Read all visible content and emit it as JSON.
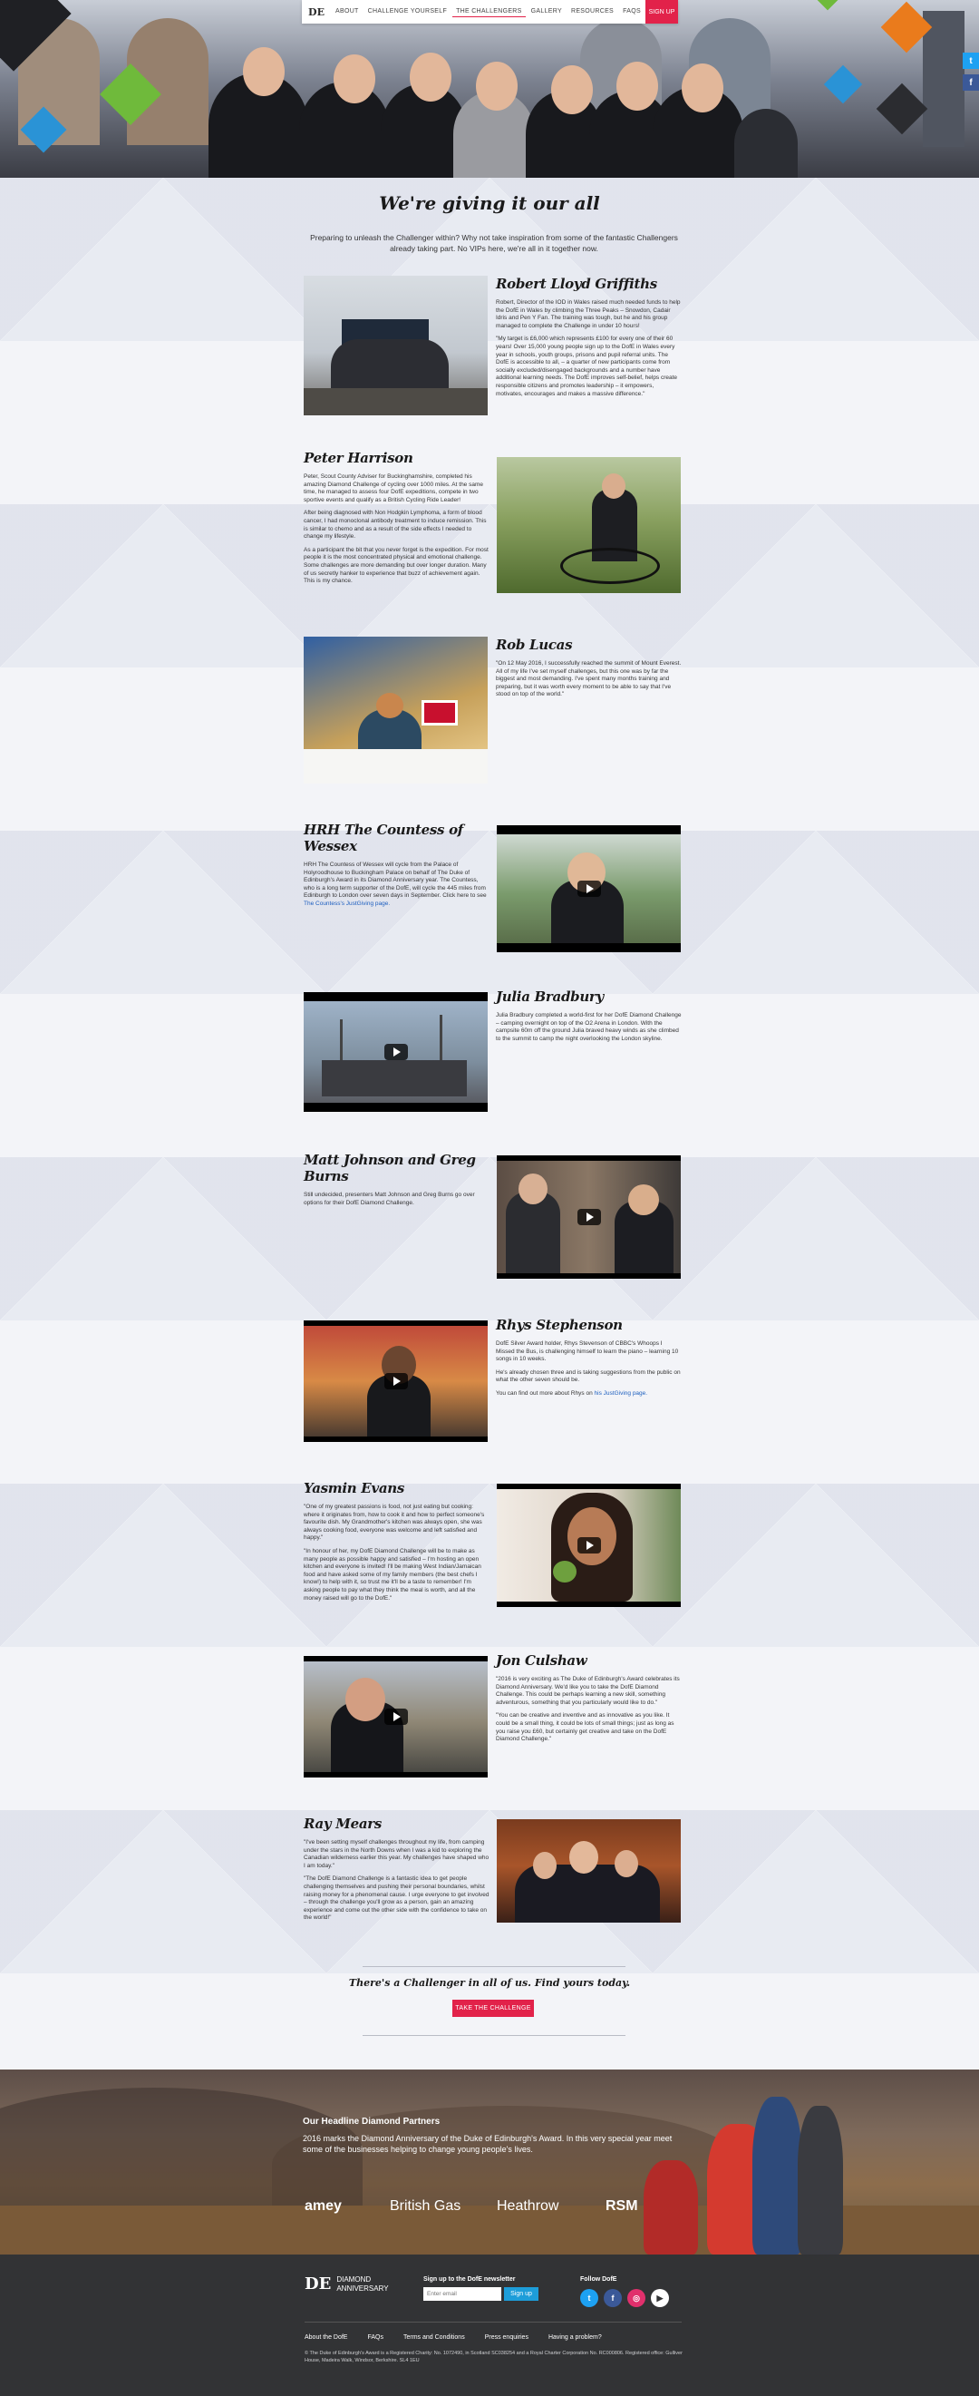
{
  "nav": {
    "logo": "DE",
    "items": [
      "ABOUT",
      "CHALLENGE YOURSELF",
      "THE CHALLENGERS",
      "GALLERY",
      "RESOURCES",
      "FAQS"
    ],
    "active_item": "THE CHALLENGERS",
    "signup": "SIGN UP"
  },
  "page": {
    "title": "We're giving it our all",
    "intro": "Preparing to unleash the Challenger within? Why not take inspiration from some of the fantastic Challengers already taking part. No VIPs here, we're all in it together now."
  },
  "profiles": [
    {
      "name": "Robert Lloyd Griffiths",
      "paragraphs": [
        "Robert, Director of the IOD in Wales raised much needed funds to help the DofE in Wales by climbing the Three Peaks – Snowdon, Cadair Idris and Pen Y Fan. The training was tough, but he and his group managed to complete the Challenge in under 10 hours!",
        "\"My target is £6,000 which represents £100 for every one of their 60 years! Over 15,000 young people sign up to the DofE in Wales every year in schools, youth groups, prisons and pupil referral units. The DofE is accessible to all, – a quarter of new participants come from socially excluded/disengaged backgrounds and a number have additional learning needs. The DofE improves self-belief, helps create responsible citizens and promotes leadership – it empowers, motivates, encourages and makes a massive difference.\""
      ]
    },
    {
      "name": "Peter Harrison",
      "paragraphs": [
        "Peter, Scout County Adviser for Buckinghamshire, completed his amazing Diamond Challenge of cycling over 1000 miles. At the same time, he managed to assess four DofE expeditions, compete in two sportive events and qualify as a British Cycling Ride Leader!",
        "After being diagnosed with Non Hodgkin Lymphoma, a form of blood cancer, I had monoclonal antibody treatment to induce remission. This is similar to chemo and as a result of the side effects I needed to change my lifestyle.",
        "As a participant the bit that you never forget is the expedition. For most people it is the most concentrated physical and emotional challenge. Some challenges are more demanding but over longer duration. Many of us secretly hanker to experience that buzz of achievement again. This is my chance."
      ]
    },
    {
      "name": "Rob Lucas",
      "paragraphs": [
        "\"On 12 May 2016, I successfully reached the summit of Mount Everest. All of my life I've set myself challenges, but this one was by far the biggest and most demanding. I've spent many months training and preparing, but it was worth every moment to be able to say that I've stood on top of the world.\""
      ]
    },
    {
      "name": "HRH The Countess of Wessex",
      "paragraphs": [
        "HRH The Countess of Wessex will cycle from the Palace of Holyroodhouse to Buckingham Palace on behalf of The Duke of Edinburgh's Award in its Diamond Anniversary year. The Countess, who is a long term supporter of the DofE, will cycle the 445 miles from Edinburgh to London over seven days in September. Click here to see"
      ],
      "link": "The Countess's JustGiving page."
    },
    {
      "name": "Julia Bradbury",
      "paragraphs": [
        "Julia Bradbury completed a world-first for her DofE Diamond Challenge – camping overnight on top of the O2 Arena in London. With the campsite 60m off the ground Julia braved heavy winds as she climbed to the summit to camp the night overlooking the London skyline."
      ]
    },
    {
      "name": "Matt Johnson and Greg Burns",
      "paragraphs": [
        "Still undecided, presenters Matt Johnson and Greg Burns go over options for their DofE Diamond Challenge."
      ]
    },
    {
      "name": "Rhys Stephenson",
      "paragraphs": [
        "DofE Silver Award holder, Rhys Stevenson of CBBC's Whoops I Missed the Bus, is challenging himself to learn the piano – learning 10 songs in 10 weeks.",
        "He's already chosen three and is taking suggestions from the public on what the other seven should be."
      ],
      "link_prefix": "You can find out more about Rhys on",
      "link": "his JustGiving page."
    },
    {
      "name": "Yasmin Evans",
      "paragraphs": [
        "\"One of my greatest passions is food, not just eating but cooking: where it originates from, how to cook it and how to perfect someone's favourite dish. My Grandmother's kitchen was always open, she was always cooking food, everyone was welcome and left satisfied and happy.\"",
        "\"In honour of her, my DofE Diamond Challenge will be to make as many people as possible happy and satisfied – I'm hosting an open kitchen and everyone is invited! I'll be making West Indian/Jamaican food and have asked some of my family members (the best chefs I know!) to help with it, so trust me it'll be a taste to remember! I'm asking people to pay what they think the meal is worth, and all the money raised will go to the DofE.\""
      ]
    },
    {
      "name": "Jon Culshaw",
      "paragraphs": [
        "\"2016 is very exciting as The Duke of Edinburgh's Award celebrates its Diamond Anniversary. We'd like you to take the DofE Diamond Challenge. This could be perhaps learning a new skill, something adventurous, something that you particularly would like to do.\"",
        "\"You can be creative and inventive and as innovative as you like. It could be a small thing, it could be lots of small things; just as long as you raise you £60, but certainly get creative and take on the DofE Diamond Challenge.\""
      ]
    },
    {
      "name": "Ray Mears",
      "paragraphs": [
        "\"I've been setting myself challenges throughout my life, from camping under the stars in the North Downs when I was a kid to exploring the Canadian wilderness earlier this year. My challenges have shaped who I am today.\"",
        "\"The DofE Diamond Challenge is a fantastic idea to get people challenging themselves and pushing their personal boundaries, whilst raising money for a phenomenal cause. I urge everyone to get involved – through the challenge you'll grow as a person, gain an amazing experience and come out the other side with the confidence to take on the world!\""
      ]
    }
  ],
  "cta": {
    "text": "There's a Challenger in all of us. Find yours today.",
    "button": "TAKE THE CHALLENGE"
  },
  "partners": {
    "title": "Our Headline Diamond Partners",
    "subtitle": "2016 marks the Diamond Anniversary of the Duke of Edinburgh's Award. In this very special year meet some of the businesses helping to change young people's lives.",
    "logos": [
      "amey",
      "British Gas",
      "Heathrow",
      "RSM"
    ]
  },
  "footer": {
    "logo_mark": "DE",
    "logo_line1": "DIAMOND",
    "logo_line2": "ANNIVERSARY",
    "newsletter_label": "Sign up to the DofE newsletter",
    "email_placeholder": "Enter email",
    "signup_button": "Sign up",
    "follow_label": "Follow DofE",
    "links": [
      "About the DofE",
      "FAQs",
      "Terms and Conditions",
      "Press enquiries",
      "Having a problem?"
    ],
    "legal": "© The Duke of Edinburgh's Award is a Registered Charity: No. 1072490, in Scotland SC038254 and a Royal Charter Corporation No. RC000806. Registered office: Gulliver House, Madeira Walk, Windsor, Berkshire. SL4 1EU"
  },
  "icons": {
    "twitter": "twitter-icon",
    "facebook": "facebook-icon",
    "instagram": "instagram-icon",
    "youtube": "youtube-icon",
    "play": "play-icon"
  },
  "colors": {
    "accent": "#e2224a",
    "link": "#1d5fbf",
    "footer_bg": "#323335",
    "signup_blue": "#1d9dd9"
  }
}
